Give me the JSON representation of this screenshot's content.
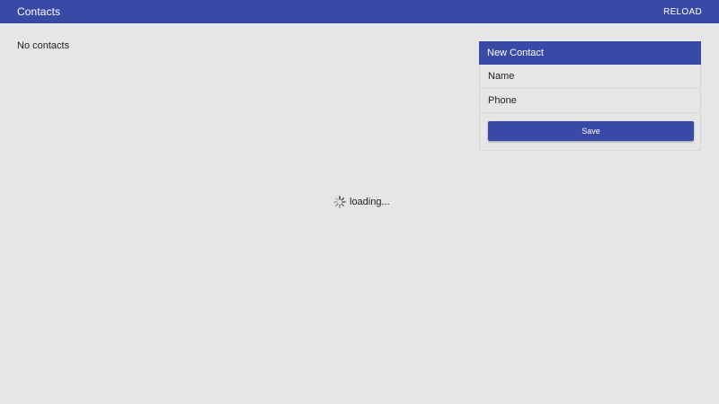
{
  "app_bar": {
    "title": "Contacts",
    "reload_label": "RELOAD",
    "color": "#3949a6"
  },
  "contacts_list": {
    "empty_text": "No contacts"
  },
  "new_contact_form": {
    "header": "New Contact",
    "name_placeholder": "Name",
    "name_value": "",
    "phone_placeholder": "Phone",
    "phone_value": "",
    "save_label": "Save"
  },
  "status": {
    "loading_text": "loading...",
    "icon": "spinner-icon"
  }
}
